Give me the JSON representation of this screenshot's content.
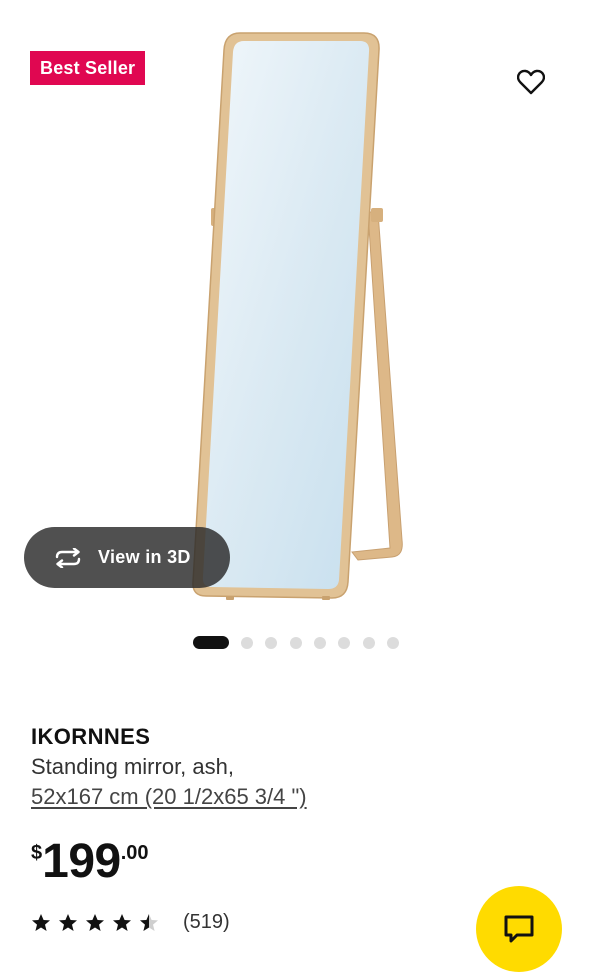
{
  "badge": {
    "label": "Best Seller",
    "color": "#e00751"
  },
  "favorite": {
    "icon": "heart-outline-icon"
  },
  "view_3d": {
    "label": "View in 3D",
    "icon": "rotate-arrows-icon"
  },
  "gallery": {
    "image_count": 8,
    "active_index": 0
  },
  "product": {
    "name": "IKORNNES",
    "description": "Standing mirror, ash,",
    "size": "52x167 cm (20 1/2x65 3/4 \")"
  },
  "price": {
    "currency": "$",
    "integer": "199",
    "decimal": ".00"
  },
  "rating": {
    "value": 4.5,
    "max": 5,
    "count_label": "(519)"
  },
  "chat": {
    "icon": "chat-bubble-icon",
    "color": "#ffdb00"
  }
}
